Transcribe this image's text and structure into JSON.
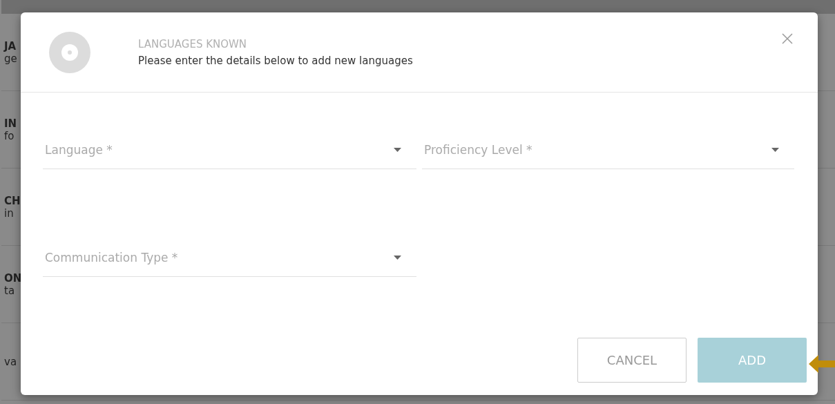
{
  "background_rows": [
    {
      "title": "JA",
      "subtitle": "ge"
    },
    {
      "title": "IN",
      "subtitle": "fo"
    },
    {
      "title": "CH",
      "subtitle": "in"
    },
    {
      "title": "ON",
      "subtitle": "ta"
    },
    {
      "subtitle": "va"
    }
  ],
  "dialog": {
    "title": "LANGUAGES KNOWN",
    "subtitle": "Please enter the details below to add new languages",
    "fields": [
      {
        "placeholder": "Language *"
      },
      {
        "placeholder": "Proficiency Level *"
      },
      {
        "placeholder": "Communication Type *"
      }
    ],
    "buttons": [
      {
        "label": "CANCEL",
        "kind": "outline",
        "disabled": false
      },
      {
        "label": "ADD",
        "kind": "primary",
        "disabled": true
      }
    ]
  }
}
